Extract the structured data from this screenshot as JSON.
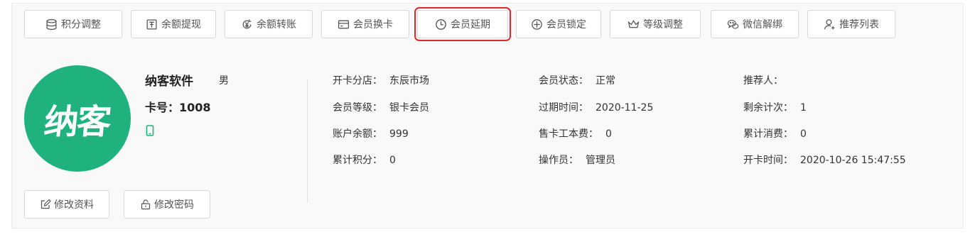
{
  "toolbar": {
    "buttons": [
      {
        "label": "积分调整",
        "icon": "database-icon"
      },
      {
        "label": "余额提现",
        "icon": "wallet-icon"
      },
      {
        "label": "余额转账",
        "icon": "yen-transfer-icon"
      },
      {
        "label": "会员换卡",
        "icon": "card-icon"
      },
      {
        "label": "会员延期",
        "icon": "clock-icon",
        "highlighted": true
      },
      {
        "label": "会员锁定",
        "icon": "target-icon"
      },
      {
        "label": "等级调整",
        "icon": "crown-icon"
      },
      {
        "label": "微信解绑",
        "icon": "wechat-icon"
      },
      {
        "label": "推荐列表",
        "icon": "user-add-icon"
      }
    ]
  },
  "member": {
    "avatar_text": "纳客",
    "name": "纳客软件",
    "gender": "男",
    "card_no": "卡号：1008",
    "avatar_color": "#20b27e",
    "phone_icon": "mobile-icon"
  },
  "info": {
    "col1": [
      {
        "label": "开卡分店：",
        "value": "东辰市场"
      },
      {
        "label": "会员等级：",
        "value": "银卡会员"
      },
      {
        "label": "账户余额：",
        "value": "999"
      },
      {
        "label": "累计积分：",
        "value": "0"
      }
    ],
    "col2": [
      {
        "label": "会员状态：",
        "value": "正常"
      },
      {
        "label": "过期时间：",
        "value": "2020-11-25"
      },
      {
        "label": "售卡工本费：",
        "value": "0"
      },
      {
        "label": "操作员：",
        "value": "管理员"
      }
    ],
    "col3": [
      {
        "label": "推荐人：",
        "value": ""
      },
      {
        "label": "剩余计次：",
        "value": "1"
      },
      {
        "label": "累计消费：",
        "value": "0"
      },
      {
        "label": "开卡时间：",
        "value": "2020-10-26 15:47:55"
      }
    ]
  },
  "actions": {
    "edit_profile": "修改资料",
    "change_password": "修改密码"
  },
  "colors": {
    "highlight_border": "#e02828",
    "accent_green": "#20b27e"
  }
}
